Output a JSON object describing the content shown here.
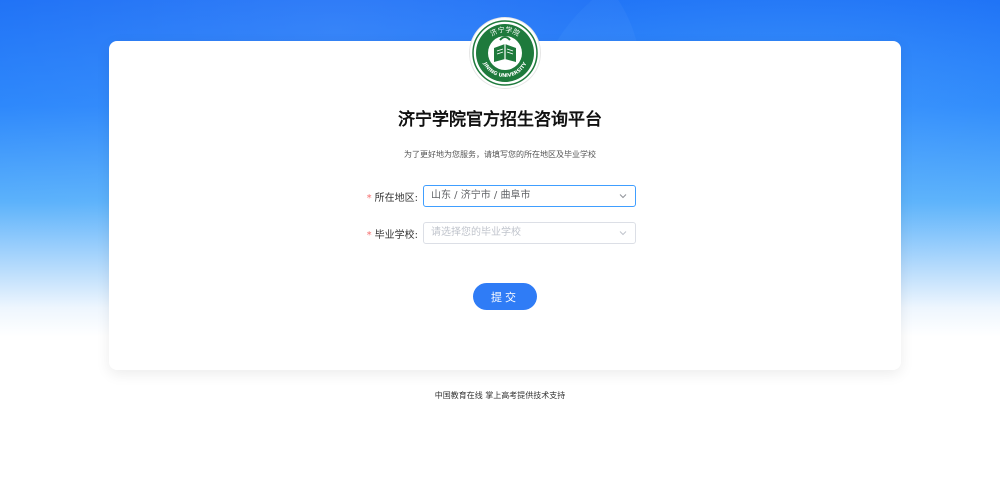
{
  "header": {
    "title": "济宁学院官方招生咨询平台",
    "subtitle": "为了更好地为您服务，请填写您的所在地区及毕业学校"
  },
  "logo": {
    "icon": "jining-university-seal",
    "text_top": "济宁学院",
    "text_bottom": "JINING UNIVERSITY"
  },
  "form": {
    "region": {
      "required_mark": "*",
      "label": "所在地区:",
      "value": "山东 / 济宁市 / 曲阜市"
    },
    "school": {
      "required_mark": "*",
      "label": "毕业学校:",
      "placeholder": "请选择您的毕业学校"
    },
    "submit_label": "提交"
  },
  "footer": {
    "text": "中国教育在线 掌上高考提供技术支持"
  },
  "colors": {
    "accent": "#2f7cf6",
    "required": "#f56c6c",
    "active_border": "#409eff",
    "logo_green": "#1e7a3c"
  }
}
